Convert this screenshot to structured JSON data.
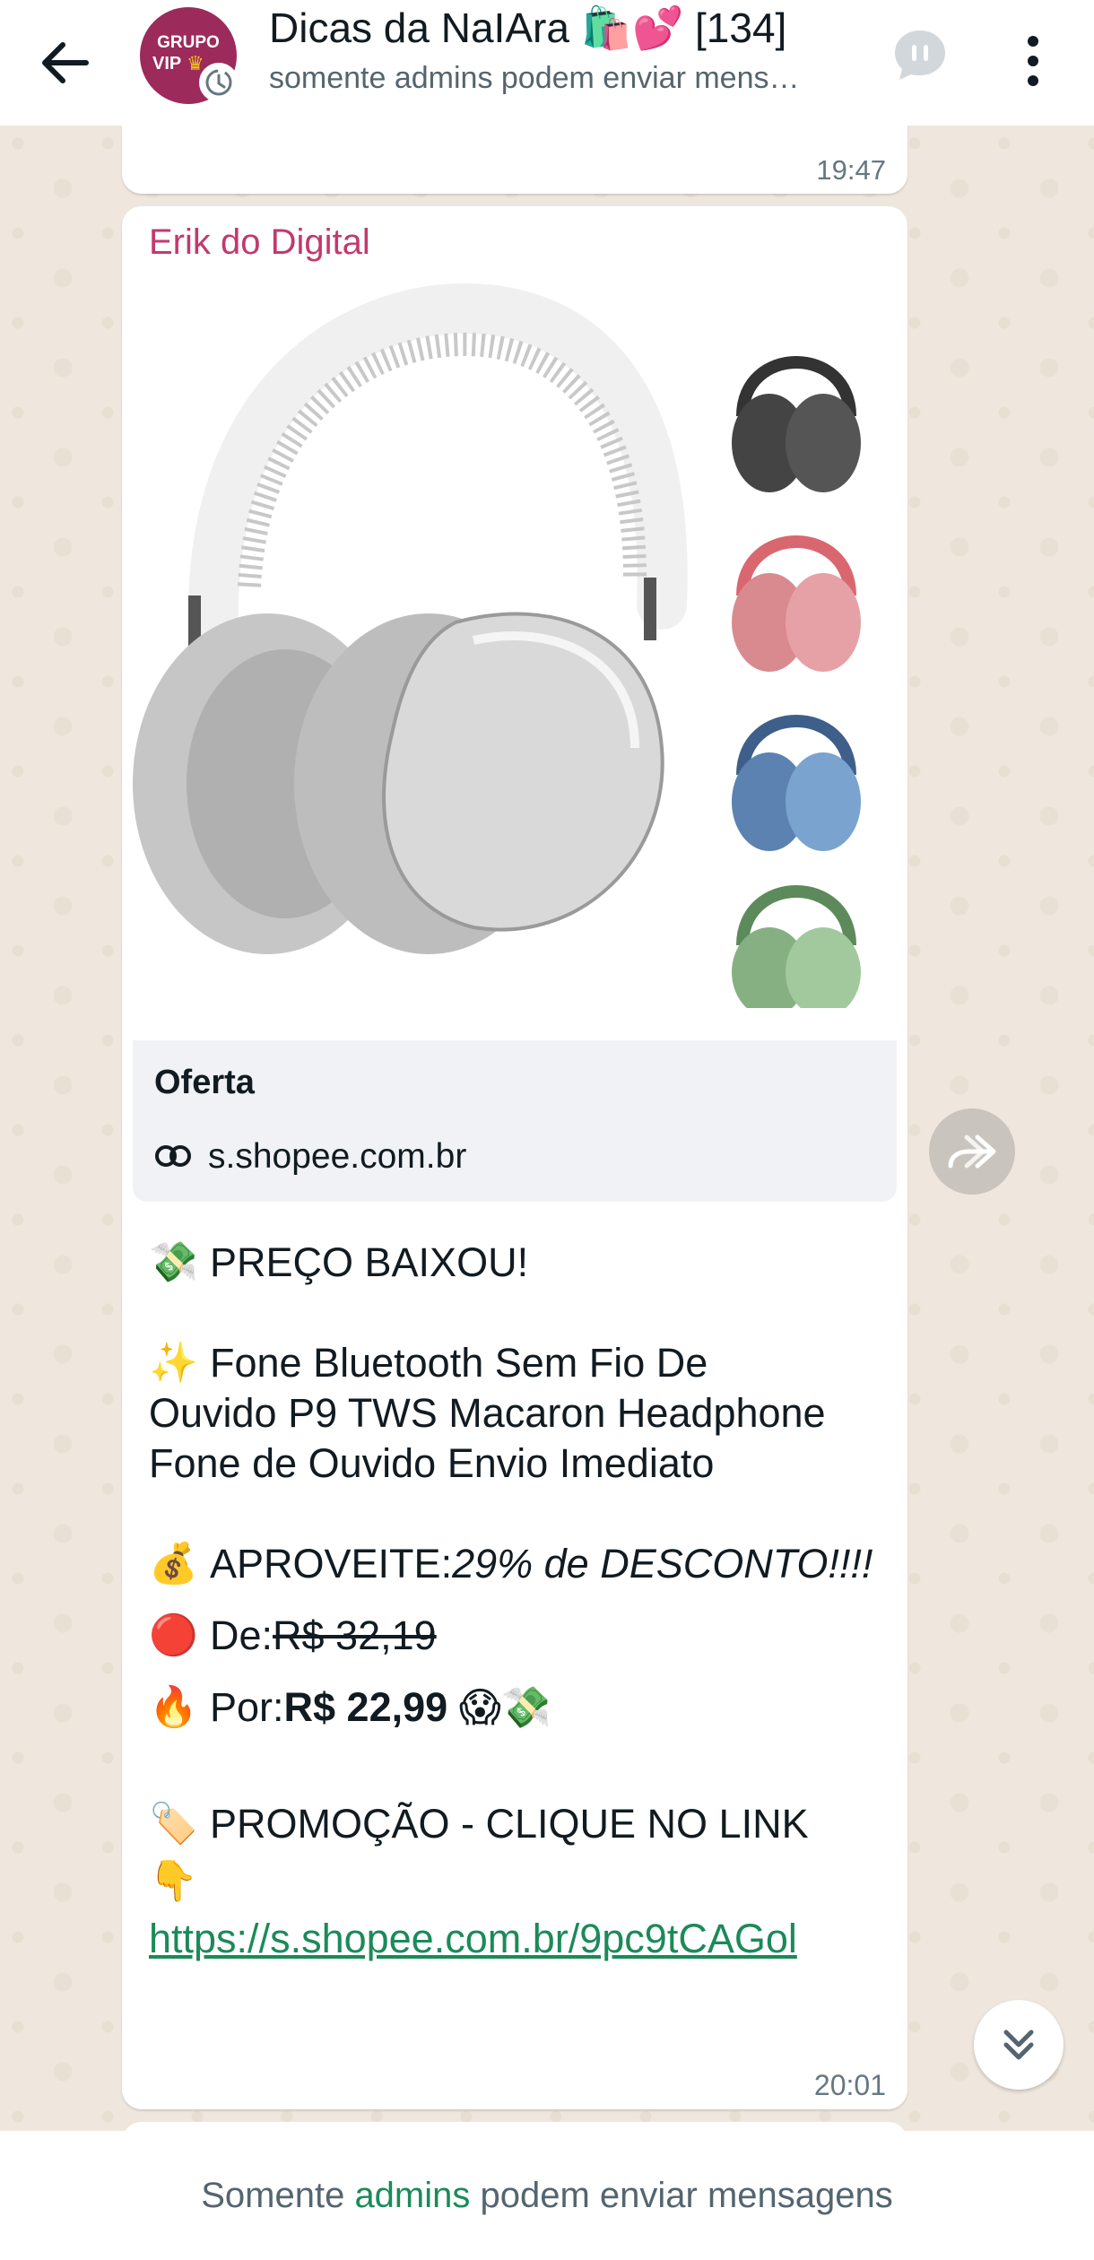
{
  "header": {
    "title": "Dicas da NaIAra 🛍️💕 [134]",
    "subtitle": "somente admins podem enviar mens…",
    "avatar_line1": "GRUPO",
    "avatar_line2": "VIP"
  },
  "previous_message": {
    "time": "19:47"
  },
  "message": {
    "sender": "Erik do Digital",
    "link_preview": {
      "title": "Oferta",
      "domain": "s.shopee.com.br"
    },
    "line1_emoji": "💸",
    "line1": "PREÇO BAIXOU!",
    "line2_emoji": "✨",
    "line2": "Fone Bluetooth Sem Fio De",
    "line3": "Ouvido  P9 TWS Macaron Headphone",
    "line4": "Fone de Ouvido  Envio Imediato",
    "aproveite_emoji": "💰",
    "aproveite_label": "APROVEITE: ",
    "aproveite_value": "29% de DESCONTO!!!!",
    "de_emoji": "🔴",
    "de_label": "De: ",
    "de_value": "R$ 32,19",
    "por_emoji": "🔥",
    "por_label": "Por: ",
    "por_value": "R$ 22,99",
    "por_suffix": "😱💸",
    "promo_emoji": "🏷️",
    "promo": "PROMOÇÃO - CLIQUE NO LINK",
    "point_emoji": "👇",
    "url": "https://s.shopee.com.br/9pc9tCAGol",
    "time": "20:01"
  },
  "footer": {
    "prefix": "Somente ",
    "admins": "admins",
    "suffix": " podem enviar mensagens"
  },
  "colors": {
    "sender": "#c2396f",
    "link": "#1b8a5a",
    "chat_bg": "#efe7dd"
  },
  "headphone_variants": [
    "silver",
    "black",
    "pink",
    "blue",
    "green"
  ]
}
